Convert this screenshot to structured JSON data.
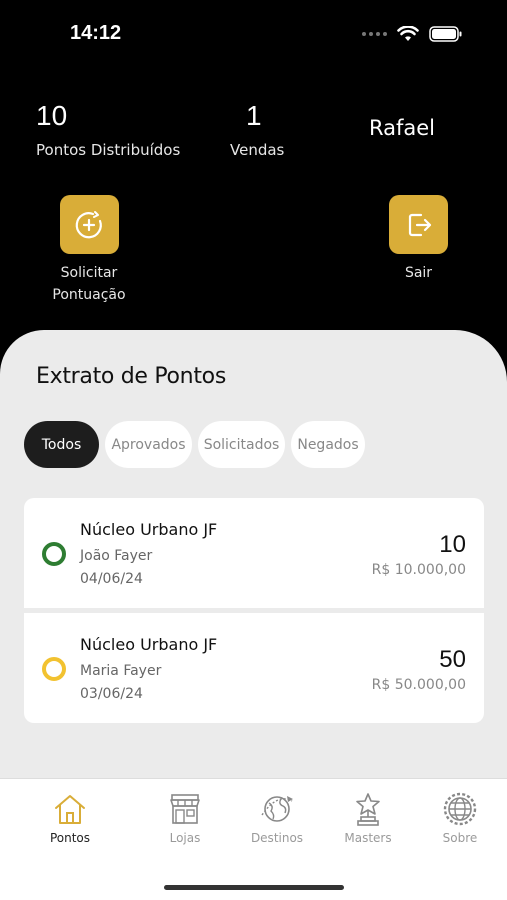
{
  "status_bar": {
    "time": "14:12"
  },
  "header": {
    "points_value": "10",
    "points_label": "Pontos Distribuídos",
    "sales_value": "1",
    "sales_label": "Vendas",
    "user_name": "Rafael"
  },
  "actions": {
    "request_label_line1": "Solicitar",
    "request_label_line2": "Pontuação",
    "logout_label": "Sair"
  },
  "statement": {
    "title": "Extrato de Pontos",
    "filters": [
      "Todos",
      "Aprovados",
      "Solicitados",
      "Negados"
    ],
    "active_filter": "Todos",
    "entries": [
      {
        "title": "Núcleo Urbano JF",
        "person": "João Fayer",
        "date": "04/06/24",
        "points": "10",
        "value": "R$ 10.000,00",
        "status_color": "#2e7d32"
      },
      {
        "title": "Núcleo Urbano JF",
        "person": "Maria Fayer",
        "date": "03/06/24",
        "points": "50",
        "value": "R$ 50.000,00",
        "status_color": "#f2c230"
      }
    ]
  },
  "tabs": [
    {
      "label": "Pontos",
      "icon": "home-icon",
      "active": true
    },
    {
      "label": "Lojas",
      "icon": "store-icon",
      "active": false
    },
    {
      "label": "Destinos",
      "icon": "globe-plane-icon",
      "active": false
    },
    {
      "label": "Masters",
      "icon": "trophy-star-icon",
      "active": false
    },
    {
      "label": "Sobre",
      "icon": "globe-gear-icon",
      "active": false
    }
  ],
  "colors": {
    "accent": "#d9ad38",
    "background_dark": "#000000",
    "sheet": "#ebebeb"
  }
}
